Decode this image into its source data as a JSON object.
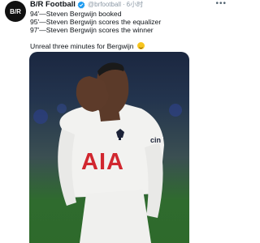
{
  "tweet": {
    "display_name": "B/R Football",
    "handle": "@brfootball",
    "time": "6小时",
    "lines": [
      "94'—Steven Bergwijn booked",
      "95'—Steven Bergwijn scores the equalizer",
      "97'—Steven Bergwijn scores the winner"
    ],
    "closing": "Unreal three minutes for Bergwijn"
  },
  "avatar": {
    "logo_text": "B/R"
  },
  "jersey": {
    "sponsor": "AIA",
    "sleeve_text": "cin"
  },
  "colors": {
    "verified": "#1d9bf0",
    "text": "#0f1419",
    "muted": "#8b98a5"
  }
}
